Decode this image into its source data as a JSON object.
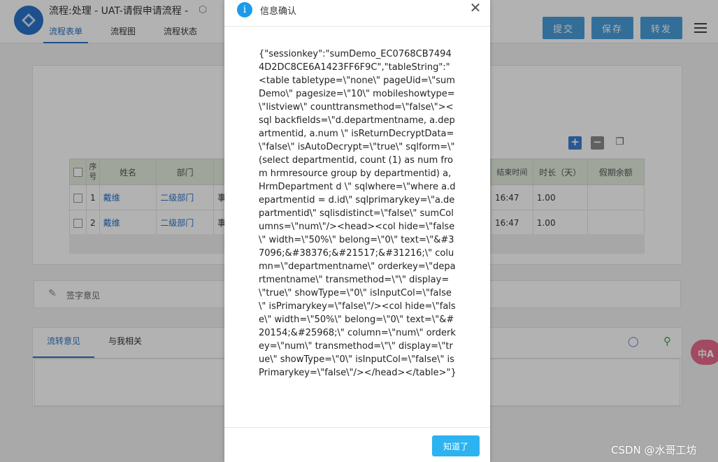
{
  "header": {
    "title": "流程:处理 - UAT-请假申请流程 -",
    "tabs": [
      "流程表单",
      "流程图",
      "流程状态"
    ],
    "buttons": [
      "提交",
      "保存",
      "转发"
    ]
  },
  "form": {
    "columns": [
      "序号",
      "姓名",
      "部门",
      "结束时间",
      "时长（天）",
      "假期余额"
    ],
    "rows": [
      {
        "no": "1",
        "name": "戴维",
        "dept": "二级部门",
        "type": "事",
        "end": "16:47",
        "duration": "1.00",
        "balance": ""
      },
      {
        "no": "2",
        "name": "戴维",
        "dept": "二级部门",
        "type": "事",
        "end": "16:47",
        "duration": "1.00",
        "balance": ""
      }
    ]
  },
  "signature": {
    "label": "签字意见"
  },
  "bottom_tabs": [
    "流转意见",
    "与我相关"
  ],
  "float_label": "中A",
  "dialog": {
    "title": "信息确认",
    "message": "{\"sessionkey\":\"sumDemo_EC0768CB74944D2DC8CE6A1423FF6F9C\",\"tableString\":\"<table tabletype=\\\"none\\\" pageUid=\\\"sumDemo\\\" pagesize=\\\"10\\\" mobileshowtype=\\\"listview\\\" counttransmethod=\\\"false\\\"><sql backfields=\\\"d.departmentname, a.departmentid, a.num \\\" isReturnDecryptData=\\\"false\\\" isAutoDecrypt=\\\"true\\\" sqlform=\\\" (select departmentid, count (1) as num from hrmresource group by departmentid) a, HrmDepartment d \\\" sqlwhere=\\\"where a.departmentid = d.id\\\" sqlprimarykey=\\\"a.departmentid\\\" sqlisdistinct=\\\"false\\\" sumColumns=\\\"num\\\"/><head><col hide=\\\"false\\\" width=\\\"50%\\\" belong=\\\"0\\\" text=\\\"&#37096;&#38376;&#21517;&#31216;\\\" column=\\\"departmentname\\\" orderkey=\\\"departmentname\\\" transmethod=\\\"\\\" display=\\\"true\\\" showType=\\\"0\\\" isInputCol=\\\"false\\\" isPrimarykey=\\\"false\\\"/><col hide=\\\"false\\\" width=\\\"50%\\\" belong=\\\"0\\\" text=\\\"&#20154;&#25968;\\\" column=\\\"num\\\" orderkey=\\\"num\\\" transmethod=\\\"\\\" display=\\\"true\\\" showType=\\\"0\\\" isInputCol=\\\"false\\\" isPrimarykey=\\\"false\\\"/></head></table>\"}",
    "ok_label": "知道了"
  },
  "watermark": "CSDN @水哥工坊"
}
